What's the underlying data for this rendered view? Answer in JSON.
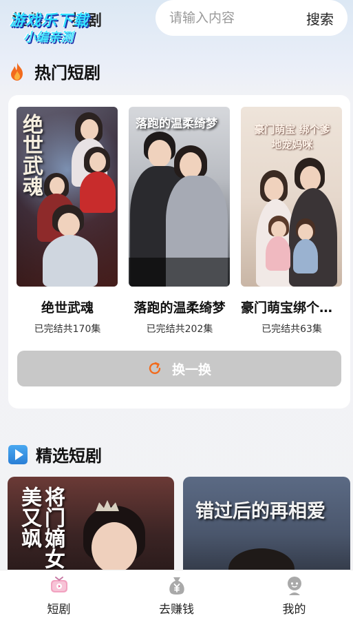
{
  "header": {
    "tabs": [
      {
        "label": "推荐"
      },
      {
        "label": "排剧"
      }
    ],
    "search": {
      "placeholder": "请输入内容",
      "button_label": "搜索"
    },
    "watermark": {
      "line1": "游戏乐下载",
      "line2": "小编亲测"
    }
  },
  "hot_section": {
    "title": "热门短剧",
    "icon": "fire-icon",
    "dramas": [
      {
        "name": "绝世武魂",
        "meta": "已完结共170集",
        "poster_text": "绝世武魂"
      },
      {
        "name": "落跑的温柔绮梦",
        "meta": "已完结共202集",
        "poster_text": "落跑的温柔绮梦"
      },
      {
        "name": "豪门萌宝绑个爹地宠妈咪",
        "meta": "已完结共63集",
        "poster_text": "豪门萌宝 绑个爹地宠妈咪"
      }
    ],
    "refresh_label": "换一换"
  },
  "featured_section": {
    "title": "精选短剧",
    "icon": "play-icon",
    "posters": [
      {
        "poster_text": "将门嫡女美又飒"
      },
      {
        "poster_text": "错过后的再相爱"
      }
    ]
  },
  "bottom_nav": {
    "items": [
      {
        "label": "短剧",
        "icon": "drama-tv-icon",
        "active": true
      },
      {
        "label": "去赚钱",
        "icon": "money-bag-icon",
        "active": false
      },
      {
        "label": "我的",
        "icon": "user-icon",
        "active": false
      }
    ]
  },
  "colors": {
    "accent_orange": "#f26b1d",
    "refresh_bg": "#c8c8c8",
    "featured_blue": "#3a8fe0"
  }
}
